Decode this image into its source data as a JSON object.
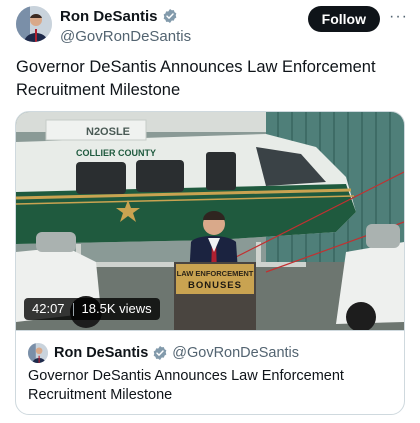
{
  "author": {
    "name": "Ron DeSantis",
    "handle": "@GovRonDeSantis",
    "verified": true
  },
  "follow_label": "Follow",
  "more_icon": "···",
  "tweet_text": "Governor DeSantis Announces Law Enforcement Recruitment Milestone",
  "media": {
    "duration": "42:07",
    "views": "18.5K views",
    "helicopter_tail_text": "N2OSLE",
    "helicopter_side_text": "COLLIER COUNTY",
    "podium_line1": "LAW ENFORCEMENT",
    "podium_line2": "BONUSES"
  },
  "quote": {
    "name": "Ron DeSantis",
    "handle": "@GovRonDeSantis",
    "text": "Governor DeSantis Announces Law Enforcement Recruitment Milestone"
  },
  "colors": {
    "follow_bg": "#0f1419",
    "verified_badge": "#829aab",
    "sheriff_green": "#1f5a3e",
    "podium_gold": "#c9a351"
  }
}
